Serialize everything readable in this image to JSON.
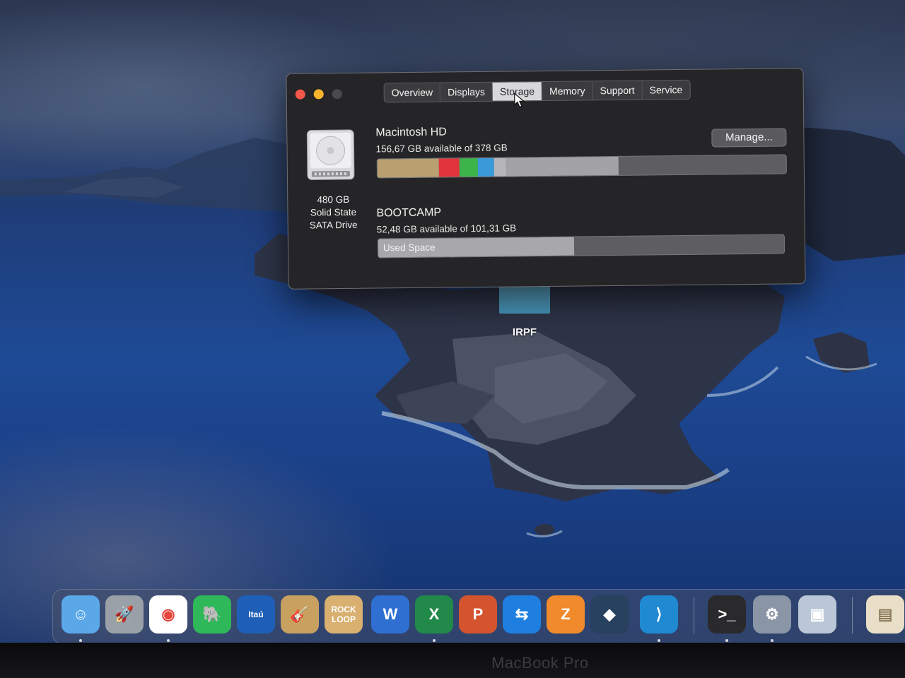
{
  "desktop": {
    "icon_label": "IRPF"
  },
  "window": {
    "tabs": [
      {
        "label": "Overview",
        "active": false
      },
      {
        "label": "Displays",
        "active": false
      },
      {
        "label": "Storage",
        "active": true
      },
      {
        "label": "Memory",
        "active": false
      },
      {
        "label": "Support",
        "active": false
      },
      {
        "label": "Service",
        "active": false
      }
    ],
    "drive": {
      "capacity": "480 GB",
      "type_line1": "Solid State",
      "type_line2": "SATA Drive"
    },
    "manage_label": "Manage...",
    "volumes": [
      {
        "name": "Macintosh HD",
        "available": "156,67 GB available of 378 GB",
        "used_fraction": 0.585,
        "segments": [
          {
            "color": "#b8a070",
            "share": 0.15
          },
          {
            "color": "#e0343c",
            "share": 0.05
          },
          {
            "color": "#3cb44a",
            "share": 0.045
          },
          {
            "color": "#3a9ad9",
            "share": 0.04
          },
          {
            "color": "#b6b6ba",
            "share": 0.03
          },
          {
            "color": "#a3a3a6",
            "share": 0.275
          }
        ]
      },
      {
        "name": "BOOTCAMP",
        "available": "52,48 GB available of 101,31 GB",
        "used_label": "Used Space",
        "used_fraction": 0.482,
        "segments": [
          {
            "color": "#a8a8ab",
            "share": 0.482
          }
        ]
      }
    ]
  },
  "dock": {
    "items": [
      {
        "name": "finder",
        "bg": "#5aa8e8",
        "glyph": "☺",
        "running": true
      },
      {
        "name": "launchpad",
        "bg": "#9aa0a8",
        "glyph": "🚀",
        "running": false
      },
      {
        "name": "chrome",
        "bg": "#ffffff",
        "glyph": "◉",
        "running": true
      },
      {
        "name": "evernote",
        "bg": "#2fb85a",
        "glyph": "🐘",
        "running": false
      },
      {
        "name": "itau",
        "bg": "#1f5fb8",
        "glyph": "Itaú",
        "running": false
      },
      {
        "name": "garageband",
        "bg": "#c8a060",
        "glyph": "🎸",
        "running": false
      },
      {
        "name": "rock-loop",
        "bg": "#d9b070",
        "glyph": "ROCK LOOP",
        "running": false
      },
      {
        "name": "word",
        "bg": "#2f6fd2",
        "glyph": "W",
        "running": false
      },
      {
        "name": "excel",
        "bg": "#218a4a",
        "glyph": "X",
        "running": true
      },
      {
        "name": "powerpoint",
        "bg": "#d4542e",
        "glyph": "P",
        "running": false
      },
      {
        "name": "teamviewer",
        "bg": "#1e7fe0",
        "glyph": "⇆",
        "running": false
      },
      {
        "name": "zeplin",
        "bg": "#f08a2a",
        "glyph": "Z",
        "running": false
      },
      {
        "name": "sourcetree",
        "bg": "#27415f",
        "glyph": "◆",
        "running": false
      },
      {
        "name": "vscode",
        "bg": "#1f8ad2",
        "glyph": "⟩",
        "running": true
      },
      {
        "name": "terminal",
        "bg": "#2a2a2c",
        "glyph": ">_",
        "running": true
      },
      {
        "name": "system-information",
        "bg": "#8a95a5",
        "glyph": "⚙",
        "running": true
      },
      {
        "name": "preview",
        "bg": "#b9c7d6",
        "glyph": "▣",
        "running": false
      },
      {
        "name": "document",
        "bg": "#e9dfc8",
        "glyph": "▤",
        "running": false
      }
    ]
  },
  "bezel": {
    "brand": "MacBook Pro"
  }
}
